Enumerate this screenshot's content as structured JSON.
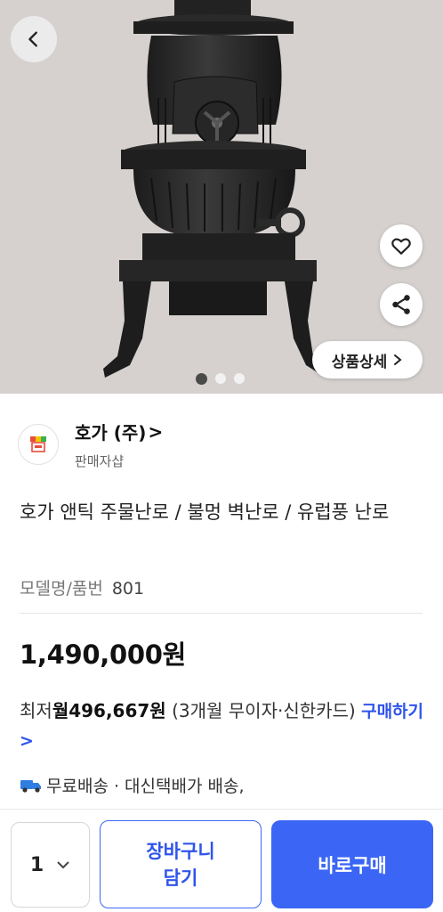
{
  "hero": {
    "icons": {
      "back": "chevron-left-icon",
      "like": "heart-outline-icon",
      "share": "share-icon",
      "detail": "chevron-right-icon"
    },
    "detail_label": "상품상세",
    "dots_total": 3,
    "active_dot": 1
  },
  "seller": {
    "name": "호가 (주)",
    "name_suffix": ">",
    "subtitle": "판매자샵",
    "logo_icon": "store-awning-icon"
  },
  "product": {
    "title": "호가 앤틱 주물난로 / 불멍 벽난로 / 유럽풍 난로",
    "model_label": "모델명/품번",
    "model_value": "801",
    "price": "1,490,000원"
  },
  "installment": {
    "prefix": "최저",
    "monthly": "월496,667원",
    "detail": "(3개월 무이자·신한카드)",
    "link": "구매하기",
    "link_arrow": ">"
  },
  "shipping": {
    "icon": "truck-icon",
    "text": "무료배송 · 대신택배가 배송,"
  },
  "bottom_bar": {
    "quantity": "1",
    "cart_line1": "장바구니",
    "cart_line2": "담기",
    "buy": "바로구매"
  },
  "colors": {
    "accent": "#3b66f5",
    "link": "#2f54eb",
    "hero_bg": "#d6d1cf"
  }
}
